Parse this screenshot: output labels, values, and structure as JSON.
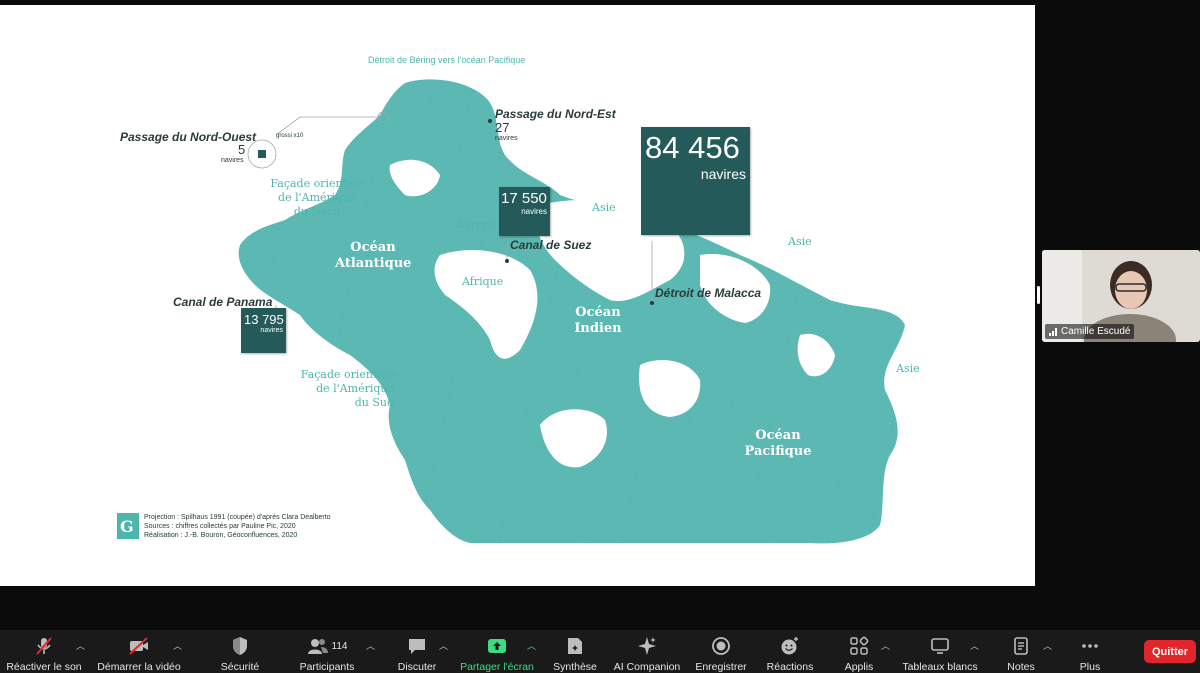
{
  "map": {
    "top_title": "Détroit de Béring vers l'océan Pacifique",
    "nw_passage": {
      "name": "Passage du Nord-Ouest",
      "count": "5",
      "unit": "navires",
      "zoom_note": "grossi x10"
    },
    "ne_passage": {
      "name": "Passage du Nord-Est",
      "count": "27",
      "unit": "navires"
    },
    "suez": {
      "name": "Canal de Suez",
      "count": "17 550",
      "unit": "navires"
    },
    "panama": {
      "name": "Canal de Panama",
      "count": "13 795",
      "unit": "navires"
    },
    "malacca": {
      "name": "Détroit de Malacca",
      "count": "84 456",
      "unit": "navires"
    },
    "oceans": {
      "atlantique_1": "Océan",
      "atlantique_2": "Atlantique",
      "indien_1": "Océan",
      "indien_2": "Indien",
      "pacifique_1": "Océan",
      "pacifique_2": "Pacifique"
    },
    "regions": {
      "amn_1": "Façade orientale",
      "amn_2": "de l'Amérique",
      "amn_3": "du Nord",
      "ams_1": "Façade orientale",
      "ams_2": "de l'Amérique",
      "ams_3": "du Sud",
      "europe": "Europe",
      "afrique": "Afrique",
      "asie_1": "Asie",
      "asie_2": "Asie",
      "asie_3": "Asie"
    },
    "credits": {
      "line1": "Projection : Spilhaus 1991 (coupée) d'après Clara Dealberto",
      "line2": "Sources : chiffres collectés par Pauline Pic, 2020",
      "line3": "Réalisation : J.-B. Bouron, Géoconfluences, 2020"
    },
    "colors": {
      "land": "#5cb8b2",
      "box": "#245a59",
      "region_text": "#4db6ac"
    }
  },
  "webcam": {
    "name": "Camille Escudé"
  },
  "toolbar": {
    "items": [
      {
        "label": "Réactiver le son",
        "icon": "mic-muted-icon"
      },
      {
        "label": "Démarrer la vidéo",
        "icon": "video-off-icon"
      },
      {
        "label": "Sécurité",
        "icon": "shield-icon"
      },
      {
        "label": "Participants",
        "icon": "participants-icon",
        "count": "114"
      },
      {
        "label": "Discuter",
        "icon": "chat-icon"
      },
      {
        "label": "Partager l'écran",
        "icon": "share-screen-icon"
      },
      {
        "label": "Synthèse",
        "icon": "summary-icon"
      },
      {
        "label": "AI Companion",
        "icon": "sparkle-icon"
      },
      {
        "label": "Enregistrer",
        "icon": "record-icon"
      },
      {
        "label": "Réactions",
        "icon": "reactions-icon"
      },
      {
        "label": "Applis",
        "icon": "apps-icon"
      },
      {
        "label": "Tableaux blancs",
        "icon": "whiteboard-icon"
      },
      {
        "label": "Notes",
        "icon": "notes-icon"
      },
      {
        "label": "Plus",
        "icon": "more-icon"
      }
    ],
    "quit_label": "Quitter"
  }
}
